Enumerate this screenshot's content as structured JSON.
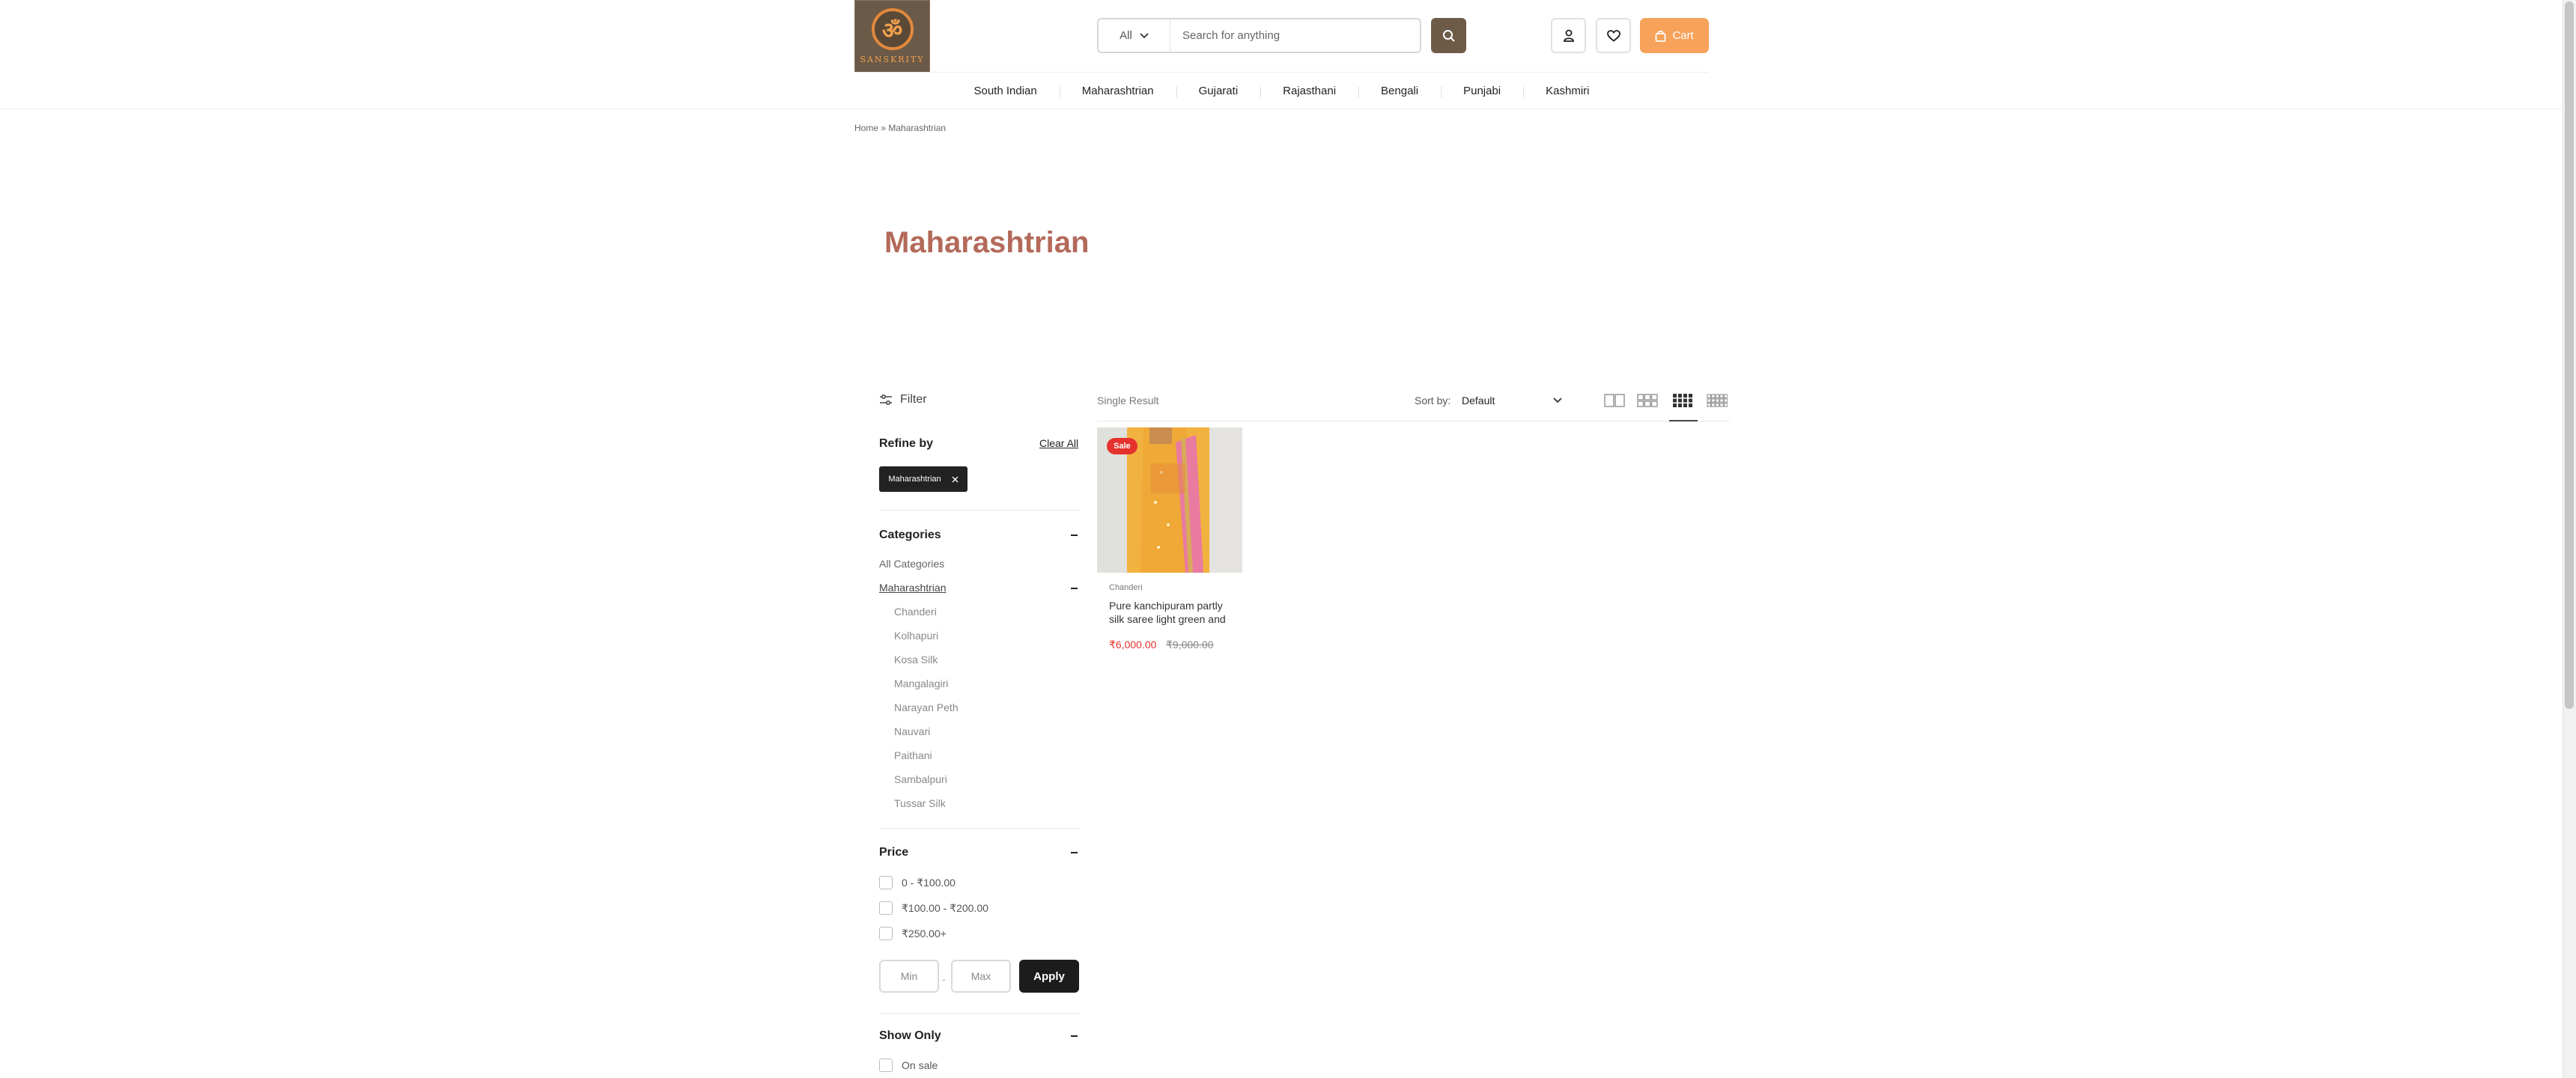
{
  "header": {
    "logo_text": "SANSKRITY",
    "search": {
      "category_label": "All",
      "placeholder": "Search for anything"
    },
    "cart_label": "Cart"
  },
  "nav": {
    "items": [
      "South Indian",
      "Maharashtrian",
      "Gujarati",
      "Rajasthani",
      "Bengali",
      "Punjabi",
      "Kashmiri"
    ]
  },
  "breadcrumb": {
    "home": "Home",
    "separator": "»",
    "current": "Maharashtrian"
  },
  "page_title": "Maharashtrian",
  "toolbar": {
    "filter_label": "Filter",
    "result_count": "Single Result",
    "sort_label": "Sort by:",
    "sort_value": "Default"
  },
  "sidebar": {
    "refine_label": "Refine by",
    "clear_all": "Clear All",
    "active_filter": "Maharashtrian",
    "categories": {
      "title": "Categories",
      "all_label": "All Categories",
      "parent": "Maharashtrian",
      "children": [
        "Chanderi",
        "Kolhapuri",
        "Kosa Silk",
        "Mangalagiri",
        "Narayan Peth",
        "Nauvari",
        "Paithani",
        "Sambalpuri",
        "Tussar Silk"
      ]
    },
    "price": {
      "title": "Price",
      "ranges": [
        "0 - ₹100.00",
        "₹100.00 - ₹200.00",
        "₹250.00+"
      ],
      "min_placeholder": "Min",
      "max_placeholder": "Max",
      "range_separator": "-",
      "apply_label": "Apply"
    },
    "show_only": {
      "title": "Show Only",
      "options": [
        "On sale"
      ]
    }
  },
  "products": [
    {
      "badge": "Sale",
      "category": "Chanderi",
      "name": "Pure kanchipuram partly silk saree light green and",
      "price": "₹6,000.00",
      "old_price": "₹9,000.00"
    }
  ],
  "colors": {
    "accent_cart": "#f7a25a",
    "title": "#b36a5a",
    "sale": "#e5322d",
    "search_button": "#6e5b47"
  }
}
